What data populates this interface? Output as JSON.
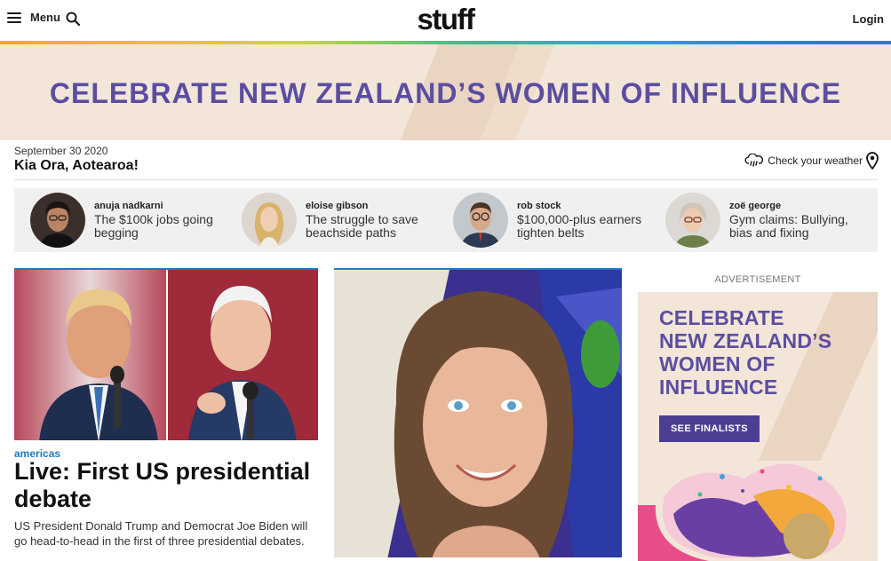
{
  "header": {
    "menu_label": "Menu",
    "logo": "stuff",
    "login_label": "Login"
  },
  "top_banner": {
    "text": "CELEBRATE NEW ZEALAND’S WOMEN OF INFLUENCE"
  },
  "dateline": {
    "date": "September 30 2020",
    "greeting": "Kia Ora, Aotearoa!",
    "weather_label": "Check your weather"
  },
  "opinion": [
    {
      "author": "anuja nadkarni",
      "title": "The $100k jobs going begging"
    },
    {
      "author": "eloise gibson",
      "title": "The struggle to save beachside paths"
    },
    {
      "author": "rob stock",
      "title": "$100,000-plus earners tighten belts"
    },
    {
      "author": "zoë george",
      "title": "Gym claims: Bullying, bias and fixing"
    }
  ],
  "main_story": {
    "category": "americas",
    "title": "Live: First US presidential debate",
    "summary": "US President Donald Trump and Democrat Joe Biden will go head-to-head in the first of three presidential debates."
  },
  "advert": {
    "label": "ADVERTISEMENT",
    "lines": [
      "CELEBRATE",
      "NEW ZEALAND’S",
      "WOMEN OF",
      "INFLUENCE"
    ],
    "button": "SEE FINALISTS"
  },
  "colors": {
    "accent_blue": "#1f7ac3",
    "banner_purple": "#5b4ea0",
    "banner_bg": "#f3e6d9"
  }
}
